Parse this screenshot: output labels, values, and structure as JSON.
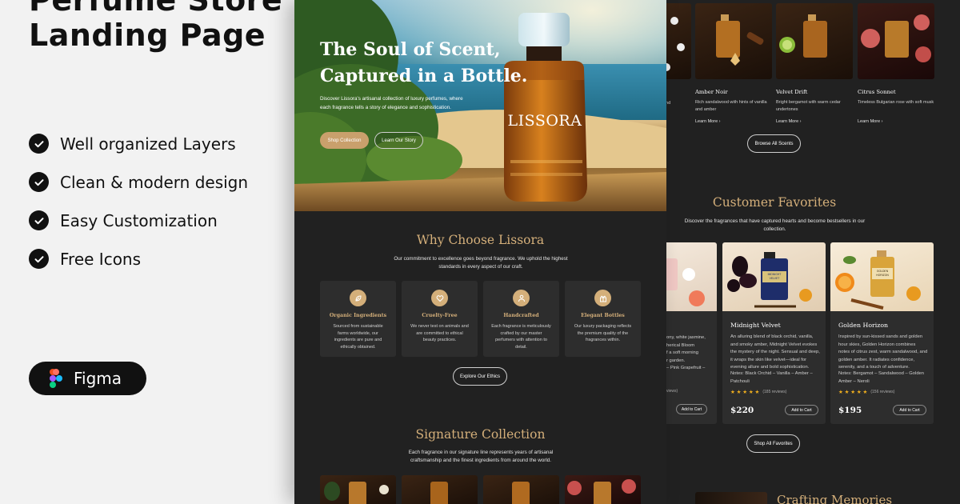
{
  "promo": {
    "title_line1": "Perfume Store",
    "title_line2": "Landing Page",
    "features": [
      "Well organized Layers",
      "Clean & modern design",
      "Easy Customization",
      "Free Icons"
    ],
    "badge_label": "Figma"
  },
  "hero": {
    "headline_line1": "The Soul of Scent,",
    "headline_line2": "Captured in a Bottle.",
    "description": "Discover Lissora's artisanal collection of luxury perfumes, where each fragrance tells a story of elegance and sophistication.",
    "primary_cta": "Shop Collection",
    "secondary_cta": "Learn Our Story",
    "bottle_label": "LISSORA"
  },
  "why": {
    "title": "Why Choose Lissora",
    "subtitle": "Our commitment to excellence goes beyond fragrance. We uphold the highest standards in every aspect of our craft.",
    "features": [
      {
        "title": "Organic Ingredients",
        "text": "Sourced from sustainable farms worldwide, our ingredients are pure and ethically obtained.",
        "icon": "leaf-icon"
      },
      {
        "title": "Cruelty-Free",
        "text": "We never test on animals and are committed to ethical beauty practices.",
        "icon": "heart-icon"
      },
      {
        "title": "Handcrafted",
        "text": "Each fragrance is meticulously crafted by our master perfumers with attention to detail.",
        "icon": "hand-icon"
      },
      {
        "title": "Elegant Bottles",
        "text": "Our luxury packaging reflects the premium quality of the fragrances within.",
        "icon": "gift-icon"
      }
    ],
    "cta": "Explore Our Ethics"
  },
  "signature": {
    "title": "Signature Collection",
    "subtitle": "Each fragrance in our signature line represents years of artisanal craftsmanship and the finest ingredients from around the world."
  },
  "collection": {
    "products": [
      {
        "name": "Amber Noir",
        "desc": "Rich sandalwood with hints of vanilla and amber",
        "link": "Learn More"
      },
      {
        "name": "Velvet Drift",
        "desc": "Bright bergamot with warm cedar undertones",
        "link": "Learn More"
      },
      {
        "name": "Citrus Sonnet",
        "desc": "Timeless Bulgarian rose with soft musk",
        "link": "Learn More"
      }
    ],
    "partial_desc_1": "and",
    "partial_link": "",
    "cta": "Browse All Scents"
  },
  "favorites": {
    "title": "Customer Favorites",
    "subtitle": "Discover the fragrances that have captured hearts and become bestsellers in our collection.",
    "partial_card": {
      "lines": [
        "ony, white jasmine,",
        "herical Bloom",
        "f a soft morning",
        "r garden."
      ],
      "notes": "– Pink Grapefruit –",
      "reviews": "views)",
      "cart": "Add to Cart"
    },
    "products": [
      {
        "name": "Midnight Velvet",
        "desc": "An alluring blend of black orchid, vanilla, and smoky amber, Midnight Velvet evokes the mystery of the night. Sensual and deep, it wraps the skin like velvet—ideal for evening allure and bold sophistication.",
        "notes": "Notes: Black Orchid – Vanilla – Amber – Patchouli",
        "stars": "★ ★ ★ ★ ★",
        "reviews": "(185 reviews)",
        "price": "$220",
        "cart": "Add to Cart",
        "bottle_label": "MIDNIGHT VELVET"
      },
      {
        "name": "Golden Horizon",
        "desc": "Inspired by sun-kissed sands and golden hour skies, Golden Horizon combines notes of citrus zest, warm sandalwood, and golden amber. It radiates confidence, serenity, and a touch of adventure.",
        "notes": "Notes: Bergamot – Sandalwood – Golden Amber – Neroli",
        "stars": "★ ★ ★ ★ ★",
        "reviews": "(156 reviews)",
        "price": "$195",
        "cart": "Add to Cart",
        "bottle_label": "GOLDEN HORIZON"
      }
    ],
    "cta": "Shop All Favorites"
  },
  "crafting": {
    "title": "Crafting Memories"
  },
  "colors": {
    "gold": "#d4af7a",
    "dark": "#212121",
    "card": "#2d2d2d",
    "star": "#f2b01e"
  }
}
